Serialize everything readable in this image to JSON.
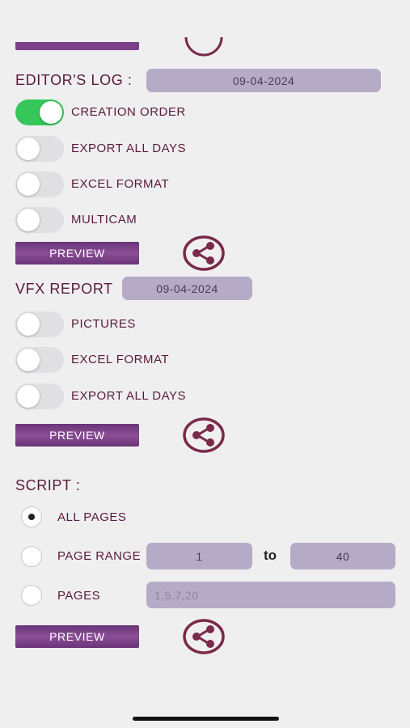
{
  "editors_log": {
    "title": "EDITOR'S LOG :",
    "date": "09-04-2024",
    "toggles": [
      {
        "label": "CREATION ORDER",
        "on": true
      },
      {
        "label": "EXPORT ALL DAYS",
        "on": false
      },
      {
        "label": "EXCEL FORMAT",
        "on": false
      },
      {
        "label": "MULTICAM",
        "on": false
      }
    ],
    "preview_label": "PREVIEW"
  },
  "vfx_report": {
    "title": "VFX REPORT",
    "date": "09-04-2024",
    "toggles": [
      {
        "label": "PICTURES",
        "on": false
      },
      {
        "label": "EXCEL FORMAT",
        "on": false
      },
      {
        "label": "EXPORT ALL DAYS",
        "on": false
      }
    ],
    "preview_label": "PREVIEW"
  },
  "script": {
    "title": "SCRIPT :",
    "options": [
      {
        "label": "ALL PAGES",
        "selected": true
      },
      {
        "label": "PAGE RANGE",
        "selected": false
      },
      {
        "label": "PAGES",
        "selected": false
      }
    ],
    "range_from": "1",
    "range_to_label": "to",
    "range_to": "40",
    "pages_placeholder": "1,5,7,20",
    "preview_label": "PREVIEW"
  },
  "icons": {
    "share": "share-icon"
  },
  "colors": {
    "accent": "#5a1a3c",
    "button": "#7a4088",
    "field": "#b6abc7",
    "toggle_on": "#35c759"
  }
}
